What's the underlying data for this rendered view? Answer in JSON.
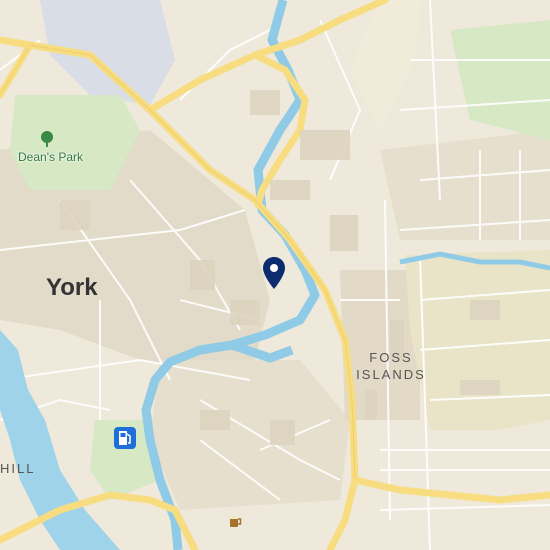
{
  "map": {
    "labels": {
      "city": "York",
      "area_line1": "FOSS",
      "area_line2": "ISLANDS",
      "park": "Dean's Park",
      "partial": "HILL"
    },
    "marker": {
      "icon": "location-pin-icon",
      "color": "#0d2c6e"
    },
    "pois": [
      {
        "icon": "tree-icon",
        "color": "#3a8b45"
      },
      {
        "icon": "fuel-pump-icon",
        "color": "#1e6fd9"
      },
      {
        "icon": "beer-mug-icon",
        "color": "#a5722a"
      }
    ],
    "colors": {
      "land": "#efe9dc",
      "city_block": "#e3dbc9",
      "park": "#d7e8c5",
      "water": "#9fd3ea",
      "water_dark": "#5ab8e0",
      "major_road": "#f7dc80",
      "minor_road": "#ffffff"
    }
  }
}
